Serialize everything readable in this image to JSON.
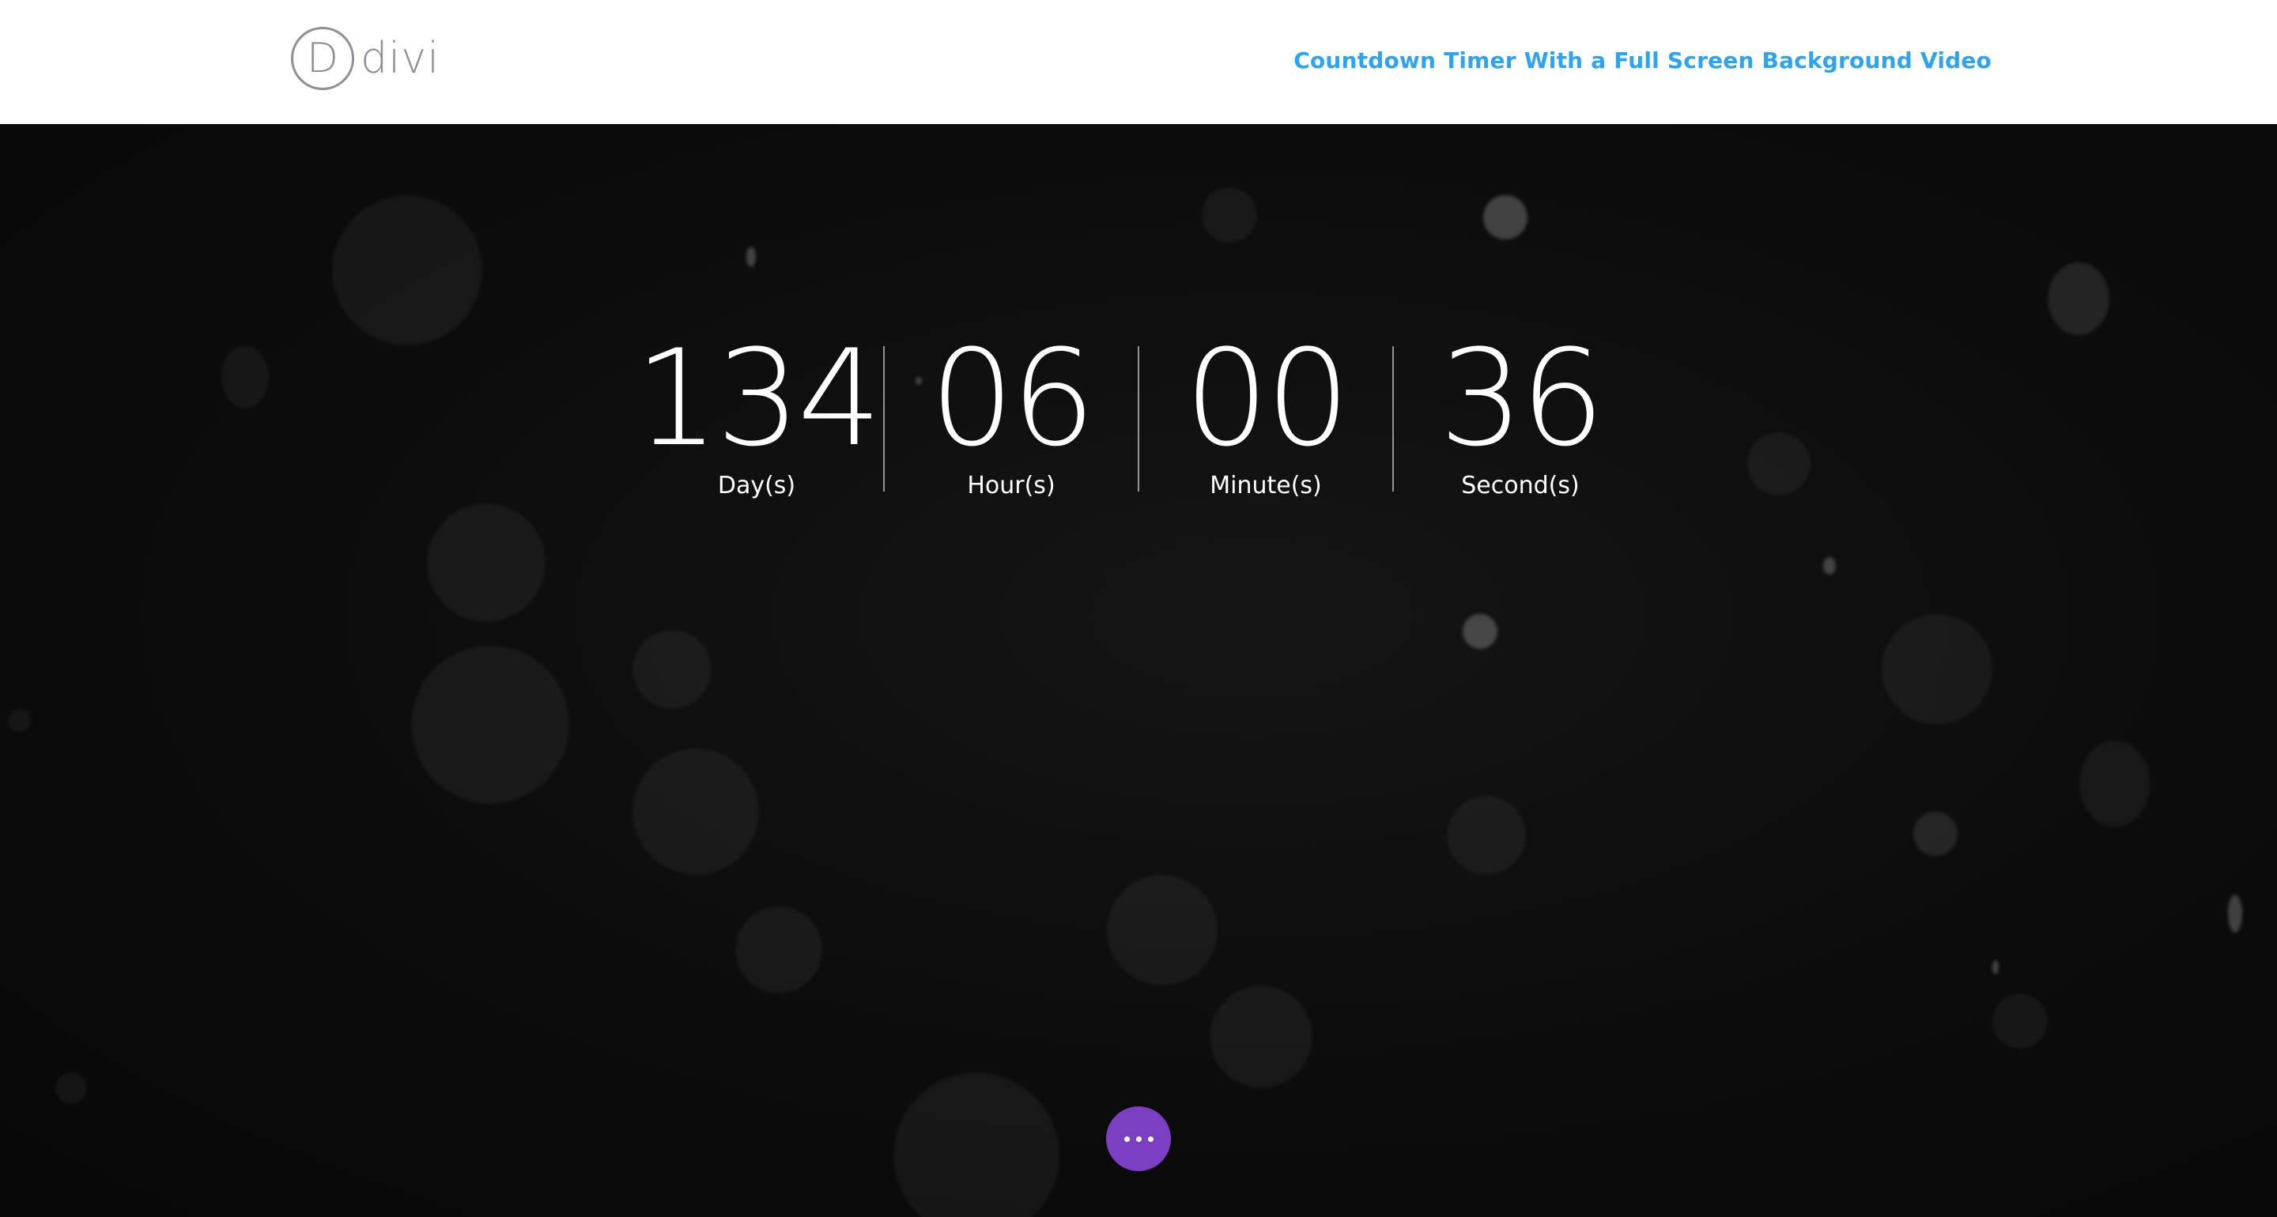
{
  "header": {
    "logo_letter": "D",
    "logo_text": "divi",
    "link_text": "Countdown Timer With a Full Screen Background Video",
    "link_color": "#2ea3f2"
  },
  "countdown": [
    {
      "value": "134",
      "label": "Day(s)"
    },
    {
      "value": "06",
      "label": "Hour(s)"
    },
    {
      "value": "00",
      "label": "Minute(s)"
    },
    {
      "value": "36",
      "label": "Second(s)"
    }
  ],
  "fab": {
    "icon": "ellipsis-icon",
    "color": "#7b3fc3"
  }
}
